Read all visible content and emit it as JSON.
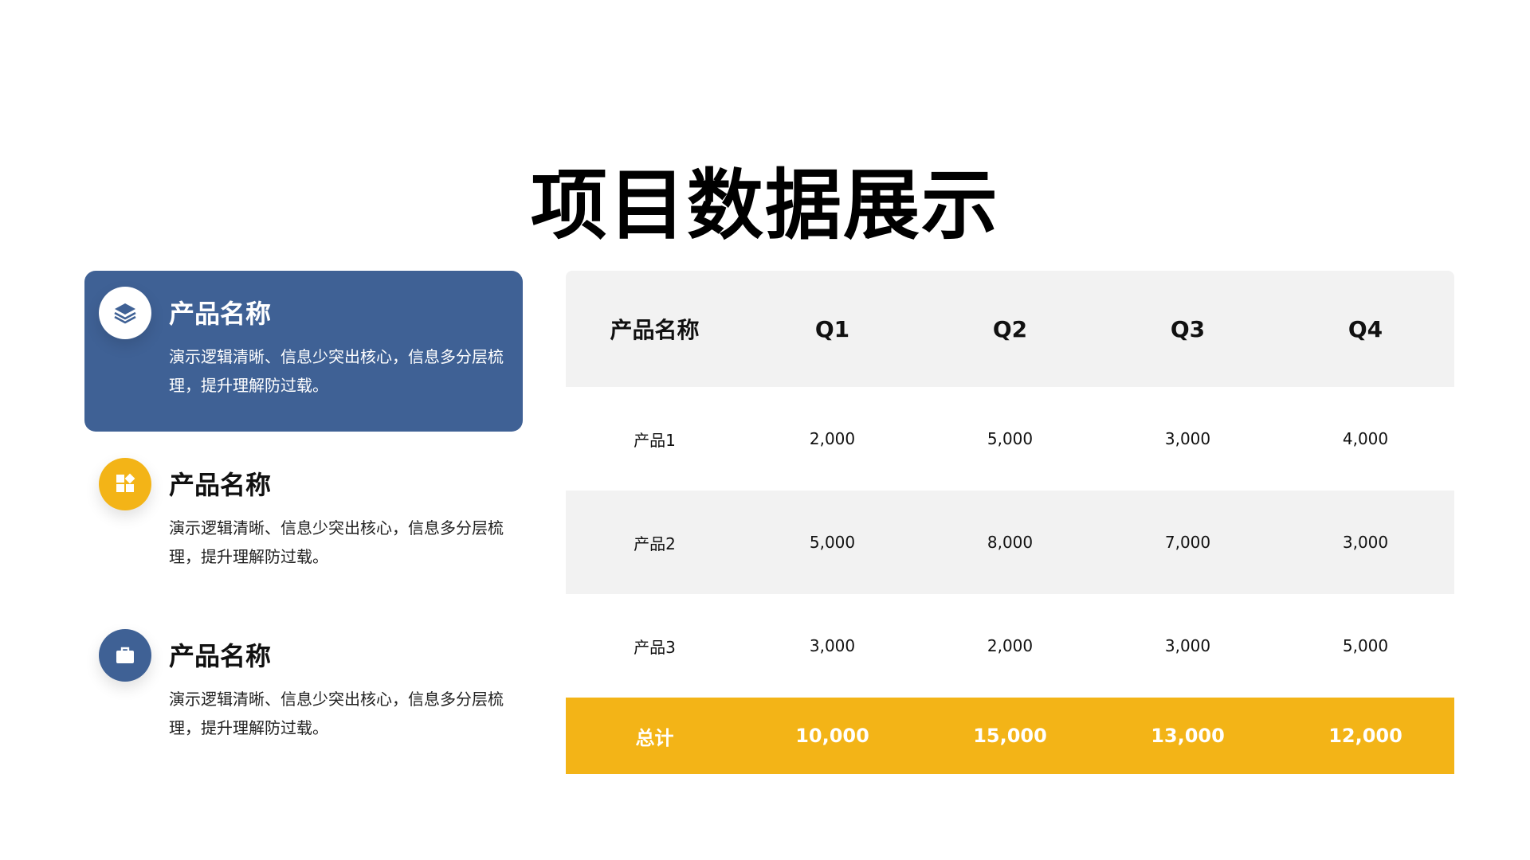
{
  "slide": {
    "title": "项目数据展示"
  },
  "colors": {
    "primary_blue": "#3f6195",
    "accent_yellow": "#f3b417",
    "table_shade": "#f2f2f2"
  },
  "features": [
    {
      "icon": "layers-icon",
      "title": "产品名称",
      "description": "演示逻辑清晰、信息少突出核心，信息多分层梳理，提升理解防过载。",
      "active": true
    },
    {
      "icon": "widgets-icon",
      "title": "产品名称",
      "description": "演示逻辑清晰、信息少突出核心，信息多分层梳理，提升理解防过载。",
      "active": false
    },
    {
      "icon": "briefcase-icon",
      "title": "产品名称",
      "description": "演示逻辑清晰、信息少突出核心，信息多分层梳理，提升理解防过载。",
      "active": false
    }
  ],
  "table": {
    "headers": [
      "产品名称",
      "Q1",
      "Q2",
      "Q3",
      "Q4"
    ],
    "rows": [
      [
        "产品1",
        "2,000",
        "5,000",
        "3,000",
        "4,000"
      ],
      [
        "产品2",
        "5,000",
        "8,000",
        "7,000",
        "3,000"
      ],
      [
        "产品3",
        "3,000",
        "2,000",
        "3,000",
        "5,000"
      ]
    ],
    "total": [
      "总计",
      "10,000",
      "15,000",
      "13,000",
      "12,000"
    ]
  }
}
